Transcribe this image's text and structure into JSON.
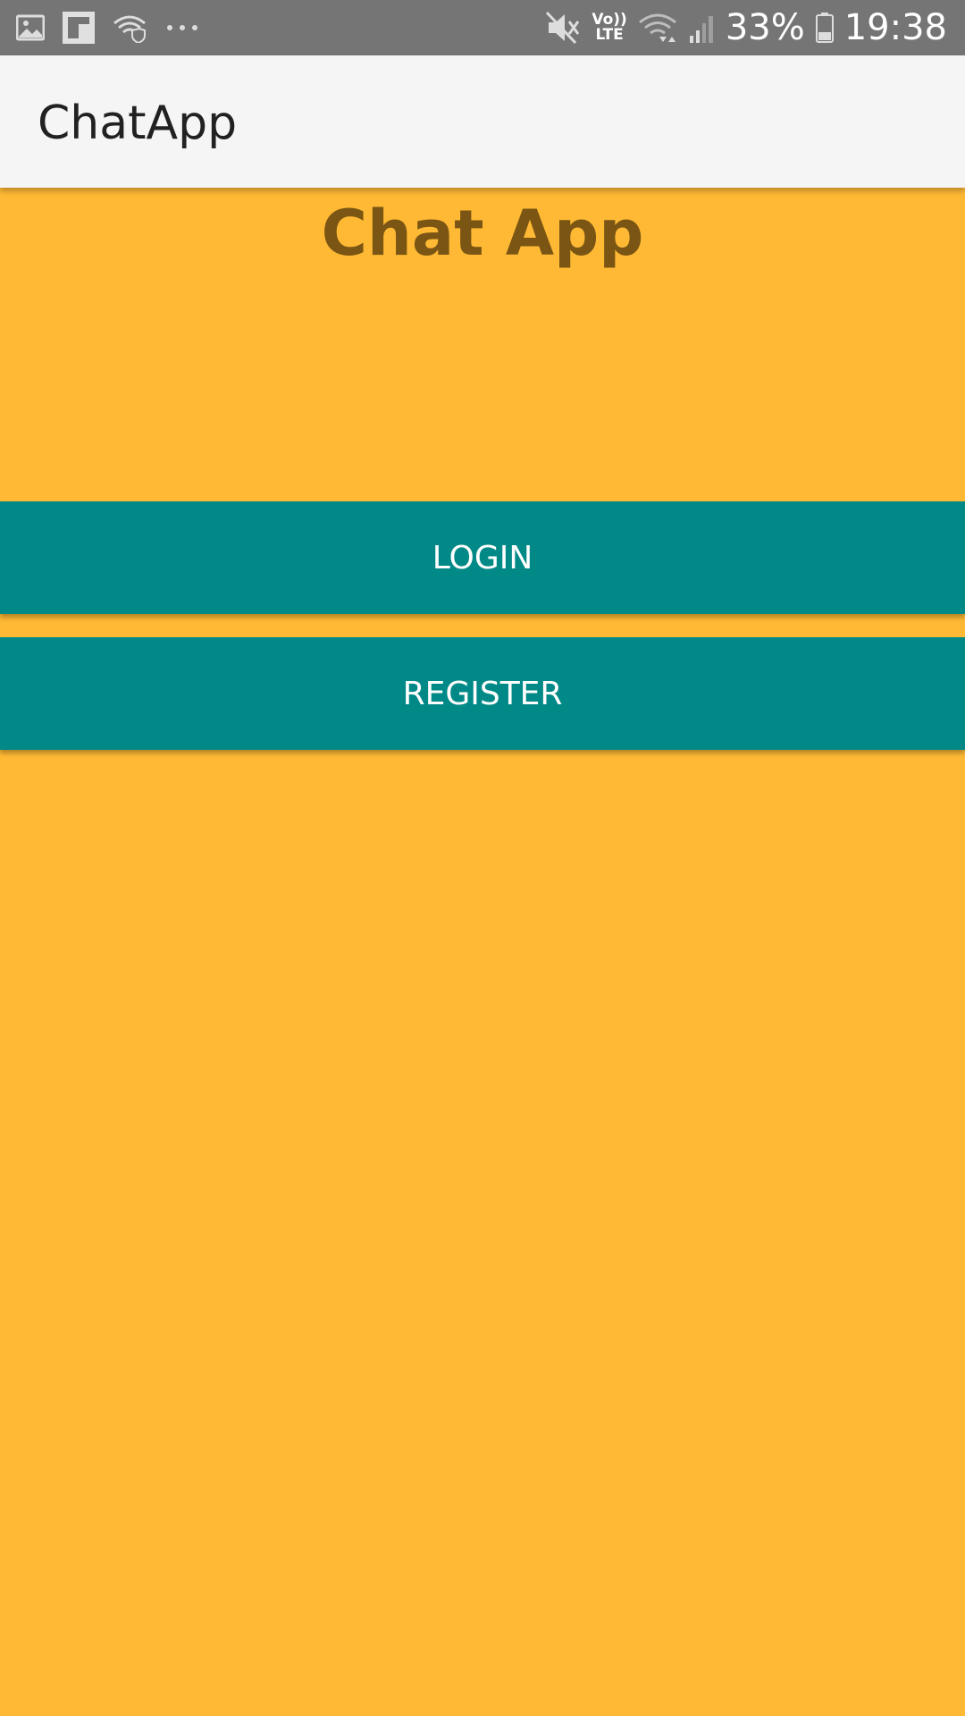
{
  "status_bar": {
    "left_icons": [
      "image-icon",
      "flipboard-icon",
      "wifi-shield-icon",
      "more-dots-icon"
    ],
    "battery_percent_text": "33%",
    "time": "19:38",
    "volte_top": "Vo))",
    "volte_bottom": "LTE"
  },
  "app_bar": {
    "title": "ChatApp"
  },
  "main": {
    "heading": "Chat App",
    "login_label": "LOGIN",
    "register_label": "REGISTER"
  },
  "colors": {
    "status_bar": "#757575",
    "app_bar": "#F5F5F5",
    "background": "#FFB934",
    "button": "#008986",
    "heading": "#7A5513"
  }
}
